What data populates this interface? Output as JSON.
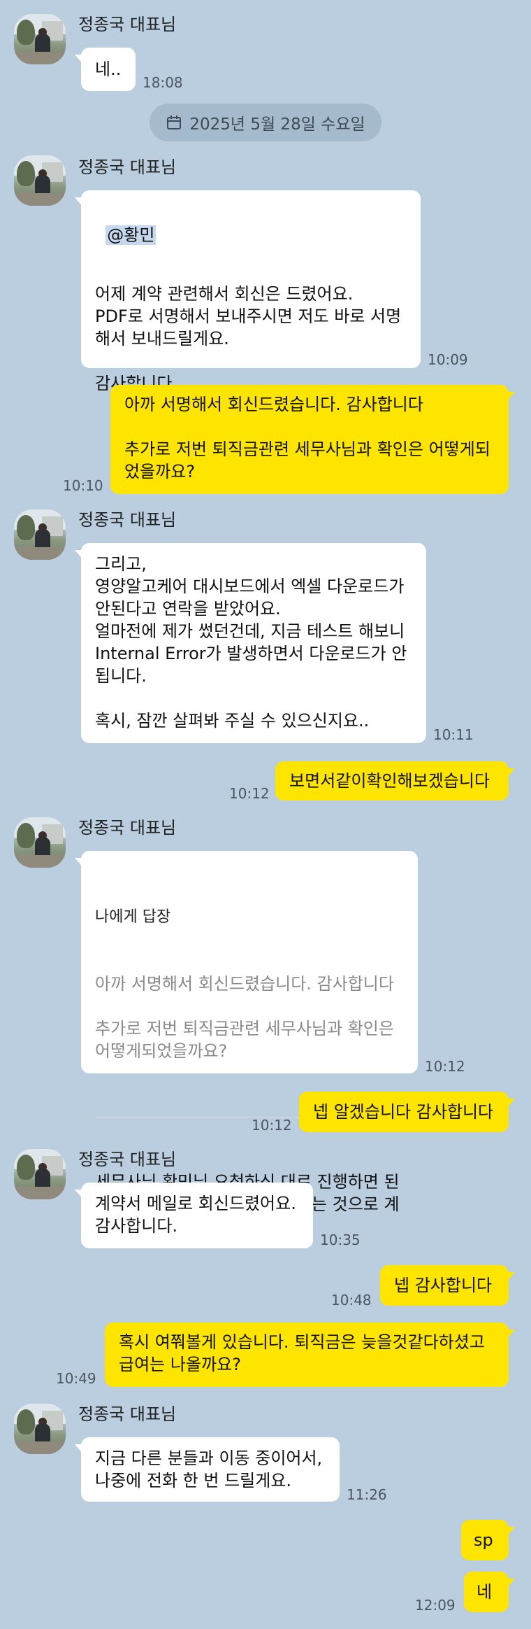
{
  "sender_name": "정종국 대표님",
  "date_divider": "2025년 5월 28일 수요일",
  "messages": {
    "m1": {
      "text": "네..",
      "time": "18:08"
    },
    "m2": {
      "mention": "@황민",
      "text": "어제 계약 관련해서 회신은 드렸어요.\nPDF로 서명해서 보내주시면 저도 바로 서명\n해서 보내드릴게요.\n\n감사합니다.",
      "time": "10:09"
    },
    "m3": {
      "text": "아까 서명해서 회신드렸습니다. 감사합니다\n\n추가로 저번 퇴직금관련 세무사님과 확인은 어떻게되\n었을까요?",
      "time": "10:10"
    },
    "m4": {
      "text": "그리고,\n영양알고케어 대시보드에서 엑셀 다운로드가\n안된다고 연락을 받았어요.\n얼마전에 제가 썼던건데, 지금 테스트 해보니\nInternal Error가 발생하면서 다운로드가 안\n됩니다.\n\n혹시, 잠깐 살펴봐 주실 수 있으신지요..",
      "time": "10:11"
    },
    "m5": {
      "text": "보면서같이확인해보겠습니다",
      "time": "10:12"
    },
    "m6": {
      "reply_label": "나에게 답장",
      "quote": "아까 서명해서 회신드렸습니다. 감사합니다\n\n추가로 저번 퇴직금관련 세무사님과 확인은\n어떻게되었을까요?",
      "text": "세무사님 황민님 요청하신 대로 진행하면 된\n다고 말씀주셔서 그대로 진행하는 것으로 계\n획하고 있어요..",
      "time": "10:12"
    },
    "m7": {
      "text": "넵 알겠습니다 감사합니다",
      "time": "10:12"
    },
    "m8": {
      "text": "계약서 메일로 회신드렸어요.\n감사합니다.",
      "time": "10:35"
    },
    "m9": {
      "text": "넵 감사합니다",
      "time": "10:48"
    },
    "m10": {
      "text": "혹시 여쭤볼게 있습니다. 퇴직금은 늦을것같다하셨고\n급여는 나올까요?",
      "time": "10:49"
    },
    "m11": {
      "text": "지금 다른 분들과 이동 중이어서,\n나중에 전화 한 번 드릴게요.",
      "time": "11:26"
    },
    "m12": {
      "text": "sp",
      "time": ""
    },
    "m13": {
      "text": "네",
      "time": "12:09"
    }
  },
  "colors": {
    "background": "#bacee0",
    "outgoing": "#fee500",
    "incoming": "#ffffff"
  }
}
